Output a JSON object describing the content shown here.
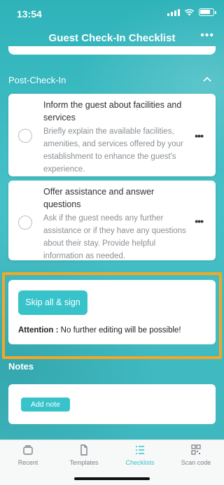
{
  "status_bar": {
    "time": "13:54"
  },
  "header": {
    "title": "Guest Check-In Checklist",
    "more_icon": "more-horizontal-icon"
  },
  "section": {
    "title": "Post-Check-In",
    "collapse_icon": "chevron-up-icon"
  },
  "tasks": [
    {
      "title": "Inform the guest about facilities and services",
      "description": "Briefly explain the available facilities, amenities, and services offered by your establishment to enhance the guest's experience."
    },
    {
      "title": "Offer assistance and answer questions",
      "description": "Ask if the guest needs any further assistance or if they have any questions about their stay. Provide helpful information as needed."
    }
  ],
  "sign": {
    "button_label": "Skip all & sign",
    "attention_label": "Attention :",
    "attention_text": " No further editing will be possible!"
  },
  "notes": {
    "title": "Notes",
    "add_label": "Add note"
  },
  "tabbar": {
    "items": [
      {
        "label": "Recent",
        "icon": "folder-icon",
        "active": false
      },
      {
        "label": "Templates",
        "icon": "document-icon",
        "active": false
      },
      {
        "label": "Checklists",
        "icon": "list-icon",
        "active": true
      },
      {
        "label": "Scan code",
        "icon": "qr-code-icon",
        "active": false
      }
    ]
  },
  "colors": {
    "accent": "#38c3cb",
    "highlight": "#f5a623",
    "background": "#3fbcc2"
  }
}
